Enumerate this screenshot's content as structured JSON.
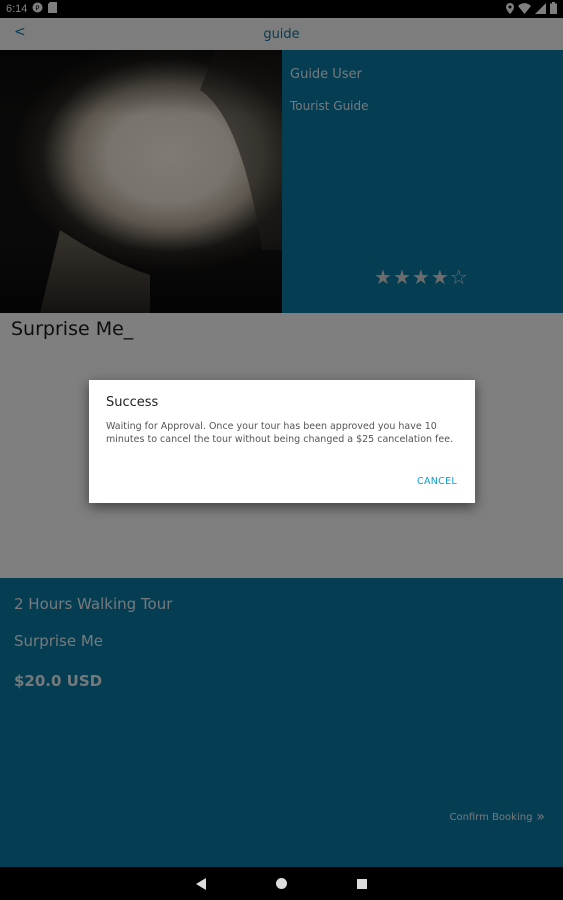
{
  "status_bar": {
    "time": "6:14"
  },
  "toolbar": {
    "back": "<",
    "title": "guide"
  },
  "guide": {
    "name": "Guide User",
    "role": "Tourist Guide",
    "rating": 4,
    "rating_max": 5
  },
  "tour": {
    "name": "Surprise Me_"
  },
  "details": {
    "duration": "2 Hours Walking Tour",
    "title": "Surprise Me",
    "price": "$20.0 USD",
    "confirm_label": "Confirm Booking"
  },
  "dialog": {
    "title": "Success",
    "message": "Waiting for Approval.  Once your tour has been approved you have 10 minutes to cancel the tour without being changed a $25 cancelation fee.",
    "cancel_label": "CANCEL"
  }
}
